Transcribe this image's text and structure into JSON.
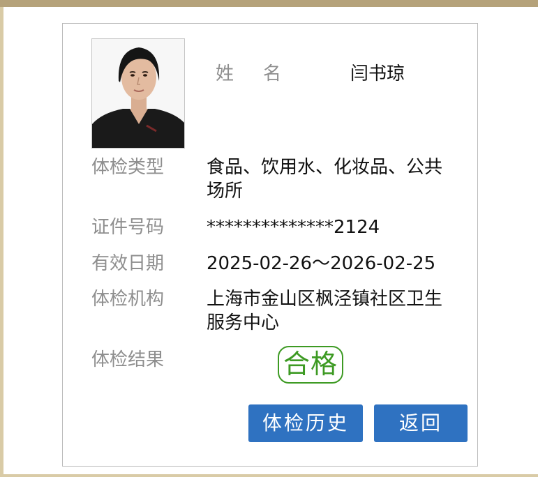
{
  "colors": {
    "frame": "#b5a27a",
    "button": "#2f72c1",
    "pass_stamp": "#3d9a23",
    "label": "#8e8e8e"
  },
  "profile": {
    "name_label": "姓　名",
    "name_value": "闫书琼"
  },
  "fields": {
    "exam_type_label": "体检类型",
    "exam_type_value": "食品、饮用水、化妆品、公共场所",
    "id_label": "证件号码",
    "id_value": "**************2124",
    "validity_label": "有效日期",
    "validity_value": "2025-02-26～2026-02-25",
    "institution_label": "体检机构",
    "institution_value": "上海市金山区枫泾镇社区卫生服务中心",
    "result_label": "体检结果",
    "result_value": "合格"
  },
  "buttons": {
    "history": "体检历史",
    "back": "返回"
  }
}
